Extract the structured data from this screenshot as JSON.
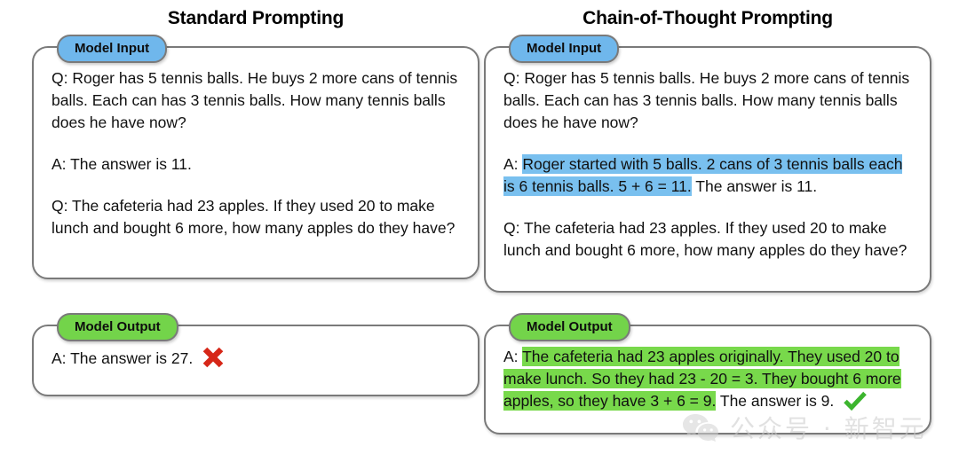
{
  "columns": {
    "left": {
      "title": "Standard Prompting",
      "input": {
        "badge": "Model Input",
        "q1": "Q: Roger has 5 tennis balls. He buys 2 more cans of tennis balls. Each can has 3 tennis balls. How many tennis balls does he have now?",
        "a1": "A: The answer is 11.",
        "q2": "Q: The cafeteria had 23 apples. If they used 20 to make lunch and bought 6 more, how many apples do they have?"
      },
      "output": {
        "badge": "Model Output",
        "answer": "A: The answer is 27.",
        "verdict": "cross-icon"
      }
    },
    "right": {
      "title": "Chain-of-Thought Prompting",
      "input": {
        "badge": "Model Input",
        "q1": "Q: Roger has 5 tennis balls. He buys 2 more cans of tennis balls. Each can has 3 tennis balls. How many tennis balls does he have now?",
        "a1_prefix": "A: ",
        "a1_highlight": "Roger started with 5 balls. 2 cans of 3 tennis balls each is 6 tennis balls. 5 + 6 = 11.",
        "a1_suffix": " The answer is 11.",
        "q2": "Q: The cafeteria had 23 apples. If they used 20 to make lunch and bought 6 more, how many apples do they have?"
      },
      "output": {
        "badge": "Model Output",
        "answer_prefix": "A: ",
        "answer_highlight": "The cafeteria had 23 apples originally. They used 20 to make lunch. So they had 23 - 20 = 3. They bought 6 more apples, so they have 3 + 6 = 9.",
        "answer_suffix": " The answer is 9.",
        "verdict": "check-icon"
      }
    }
  },
  "watermark": {
    "logo": "wechat-icon",
    "text": "公众号 · 新智元"
  },
  "colors": {
    "input_badge": "#6fb7ec",
    "output_badge": "#73d44a",
    "blue_highlight": "#79c0ef",
    "green_highlight": "#78d94b",
    "cross": "#d62718",
    "check": "#3cb52e",
    "panel_border": "#7a7a7a"
  }
}
